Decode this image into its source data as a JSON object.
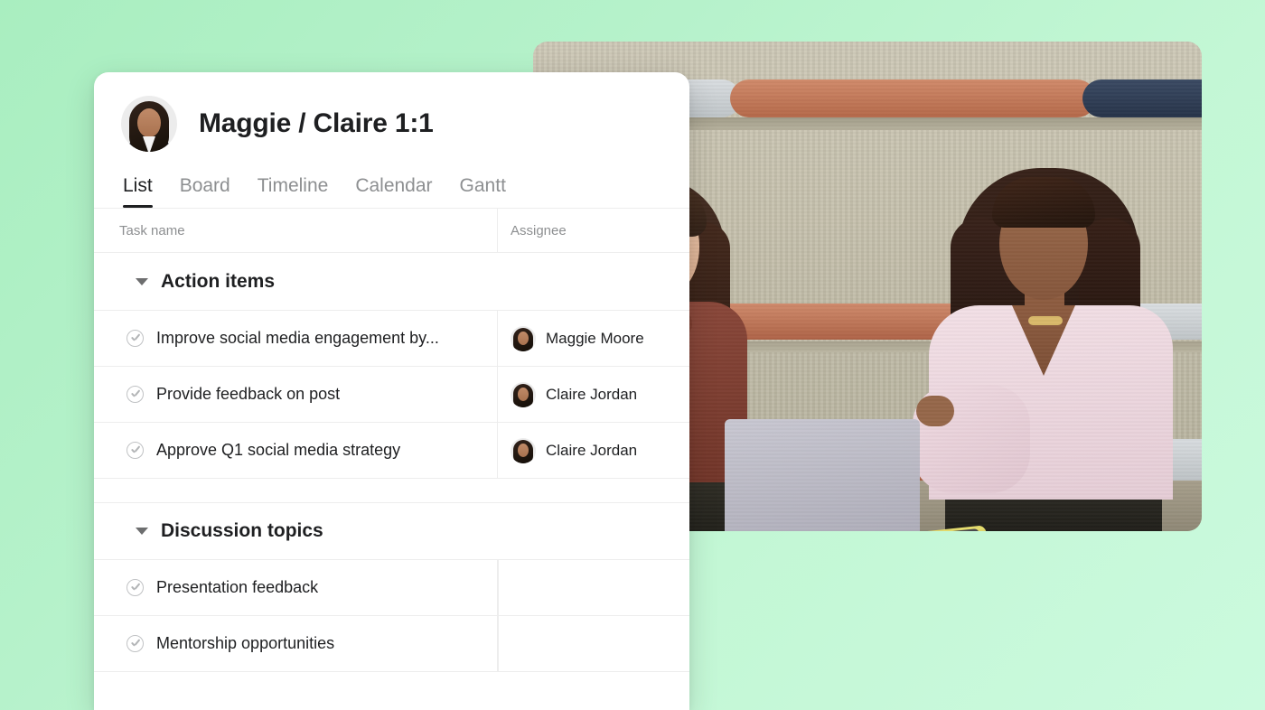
{
  "background": {
    "gradient_from": "#a9eec0",
    "gradient_to": "#cbfade"
  },
  "photo": {
    "alt": "Two women sitting on a bench talking across a round white table with a laptop",
    "scene_items": [
      "laptop",
      "round-table",
      "smartphone",
      "bench-cushions"
    ]
  },
  "card": {
    "avatar_name": "project-avatar",
    "title": "Maggie / Claire 1:1",
    "tabs": [
      {
        "label": "List",
        "active": true
      },
      {
        "label": "Board",
        "active": false
      },
      {
        "label": "Timeline",
        "active": false
      },
      {
        "label": "Calendar",
        "active": false
      },
      {
        "label": "Gantt",
        "active": false
      }
    ],
    "columns": {
      "task_name": "Task name",
      "assignee": "Assignee"
    },
    "groups": [
      {
        "title": "Action items",
        "expanded": true,
        "tasks": [
          {
            "name": "Improve social media engagement by...",
            "assignee": "Maggie Moore",
            "completed": false
          },
          {
            "name": "Provide feedback on post",
            "assignee": "Claire Jordan",
            "completed": false
          },
          {
            "name": "Approve Q1 social media strategy",
            "assignee": "Claire Jordan",
            "completed": false
          }
        ]
      },
      {
        "title": "Discussion topics",
        "expanded": true,
        "tasks": [
          {
            "name": "Presentation feedback",
            "assignee": "",
            "completed": false
          },
          {
            "name": "Mentorship opportunities",
            "assignee": "",
            "completed": false
          }
        ]
      }
    ]
  }
}
